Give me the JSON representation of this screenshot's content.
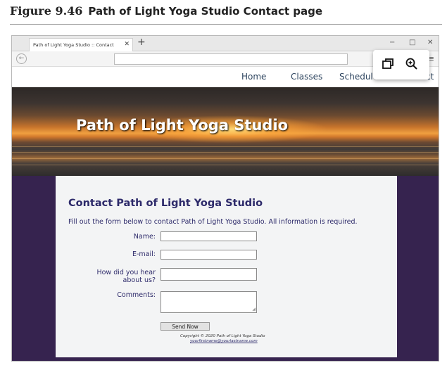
{
  "figure": {
    "number": "Figure 9.46",
    "title": "Path of Light Yoga Studio Contact page"
  },
  "browser": {
    "tab_title": "Path of Light Yoga Studio :: Contact",
    "tab_close": "✕",
    "new_tab": "+",
    "win_min": "−",
    "win_max": "□",
    "win_close": "✕",
    "back": "←",
    "menu": "≡",
    "url": ""
  },
  "nav": {
    "items": [
      {
        "label": "Home"
      },
      {
        "label": "Classes"
      },
      {
        "label": "Schedule"
      },
      {
        "label": "ct"
      }
    ]
  },
  "banner": {
    "title": "Path of Light Yoga Studio"
  },
  "content": {
    "heading": "Contact Path of Light Yoga Studio",
    "intro": "Fill out the form below to contact Path of Light Yoga Studio. All information is required.",
    "form": {
      "name_label": "Name:",
      "email_label": "E-mail:",
      "hear_label_1": "How did you hear",
      "hear_label_2": "about us?",
      "comments_label": "Comments:",
      "name_value": "",
      "email_value": "",
      "hear_value": "",
      "comments_value": "",
      "submit_label": "Send Now"
    },
    "footer": {
      "copyright": "Copyright © 2020 Path of Light Yoga Studio",
      "email": "yourfirstname@yourlastname.com"
    }
  },
  "colors": {
    "purple": "#36234f",
    "heading": "#2d2a6a",
    "nav": "#2f4660"
  },
  "icons": {
    "popup": [
      "restore-window-icon",
      "zoom-in-icon"
    ]
  }
}
